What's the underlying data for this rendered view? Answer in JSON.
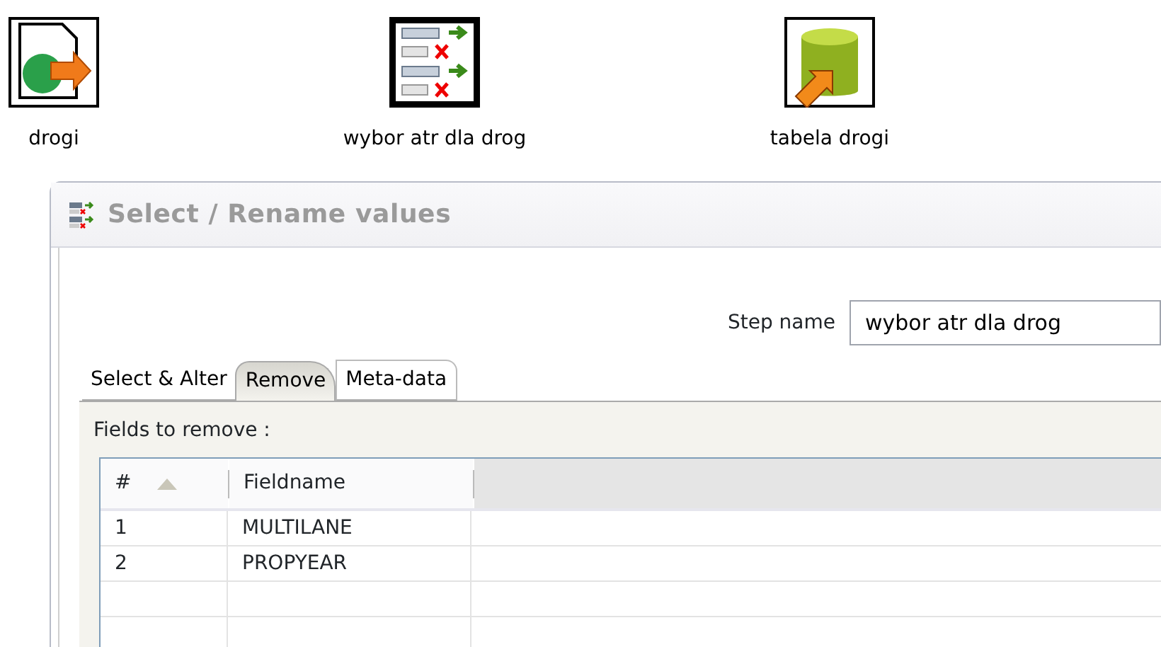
{
  "canvas": {
    "steps": [
      {
        "kind": "input",
        "label": "drogi",
        "selected": false
      },
      {
        "kind": "select",
        "label": "wybor atr dla drog",
        "selected": true
      },
      {
        "kind": "output",
        "label": "tabela drogi",
        "selected": false
      }
    ]
  },
  "dialog": {
    "title": "Select / Rename values",
    "step_name": {
      "label": "Step name",
      "value": "wybor atr dla drog"
    },
    "tabs": [
      {
        "label": "Select & Alter",
        "selected": false
      },
      {
        "label": "Remove",
        "selected": true
      },
      {
        "label": "Meta-data",
        "selected": false
      }
    ],
    "fields_label": "Fields to remove :",
    "table": {
      "columns": [
        "#",
        "Fieldname"
      ],
      "rows": [
        [
          "1",
          "MULTILANE"
        ],
        [
          "2",
          "PROPYEAR"
        ]
      ]
    }
  }
}
